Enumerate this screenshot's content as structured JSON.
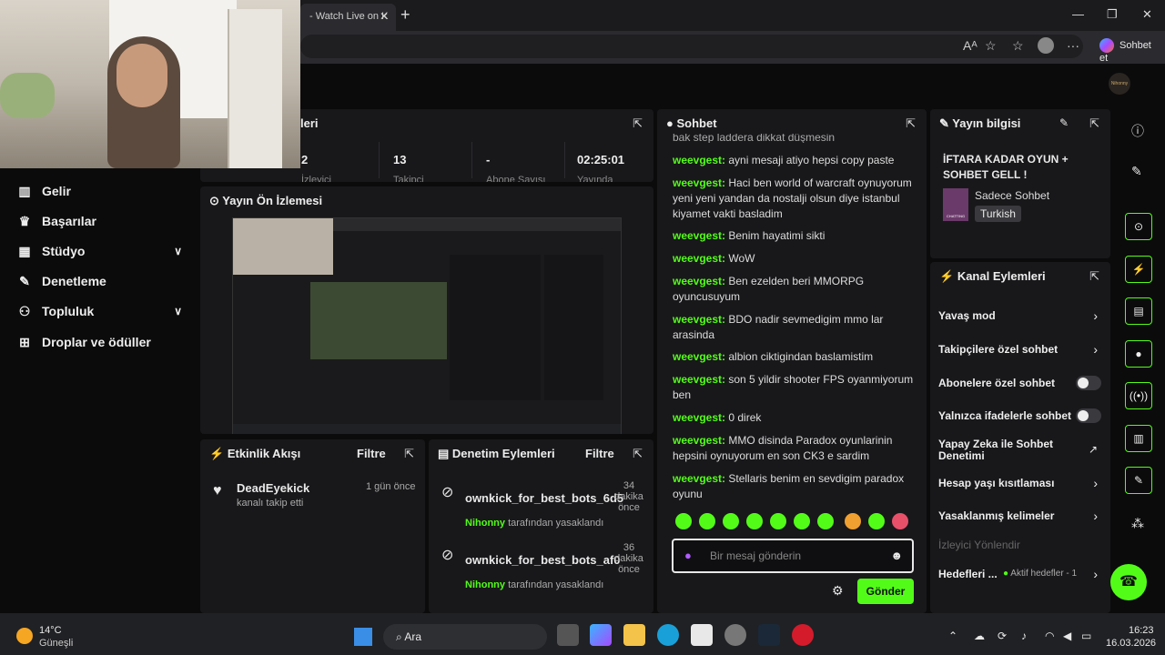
{
  "browser": {
    "tab_title": "- Watch Live on K",
    "copilot_label": "Sohbet et"
  },
  "sidebar": {
    "items": [
      {
        "label": "Gelir",
        "icon": "chart-icon"
      },
      {
        "label": "Başarılar",
        "icon": "trophy-icon"
      },
      {
        "label": "Stüdyo",
        "icon": "studio-icon",
        "expandable": true
      },
      {
        "label": "Denetleme",
        "icon": "wrench-icon"
      },
      {
        "label": "Topluluk",
        "icon": "people-icon",
        "expandable": true
      },
      {
        "label": "Droplar ve ödüller",
        "icon": "gift-icon"
      }
    ]
  },
  "stats_panel": {
    "title": "leri",
    "stats": [
      {
        "value": "2",
        "label": "İzleyici"
      },
      {
        "value": "13",
        "label": "Takipçi"
      },
      {
        "value": "-",
        "label": "Abone Sayısı"
      },
      {
        "value": "02:25:01",
        "label": "Yayında"
      }
    ]
  },
  "preview_panel": {
    "title": "Yayın Ön İzlemesi"
  },
  "activity_panel": {
    "title": "Etkinlik Akışı",
    "filter": "Filtre",
    "events": [
      {
        "user": "DeadEyekick",
        "action": "kanalı takip etti",
        "time": "1 gün önce"
      }
    ]
  },
  "mod_panel": {
    "title": "Denetim Eylemleri",
    "filter": "Filtre",
    "actions": [
      {
        "user": "ownkick_for_best_bots_6d5",
        "time_num": "34",
        "time_unit": "dakika",
        "time_ago": "önce",
        "by": "Nihonny",
        "by_suffix": "tarafından yasaklandı"
      },
      {
        "user": "ownkick_for_best_bots_af0",
        "time_num": "36",
        "time_unit": "dakika",
        "time_ago": "önce",
        "by": "Nihonny",
        "by_suffix": "tarafından yasaklandı"
      }
    ]
  },
  "chat_panel": {
    "title": "Sohbet",
    "partial_top": "bak step laddera dikkat düşmesin",
    "messages": [
      {
        "user": "weevgest:",
        "text": "ayni mesaji atiyo hepsi copy paste"
      },
      {
        "user": "weevgest:",
        "text": "Haci ben world of warcraft oynuyorum yeni yeni yandan da nostalji olsun diye istanbul kiyamet vakti basladim"
      },
      {
        "user": "weevgest:",
        "text": "Benim hayatimi sikti"
      },
      {
        "user": "weevgest:",
        "text": "WoW"
      },
      {
        "user": "weevgest:",
        "text": "Ben ezelden beri MMORPG oyuncusuyum"
      },
      {
        "user": "weevgest:",
        "text": "BDO nadir sevmedigim mmo lar arasinda"
      },
      {
        "user": "weevgest:",
        "text": "albion ciktigindan baslamistim"
      },
      {
        "user": "weevgest:",
        "text": "son 5 yildir shooter FPS oyanmiyorum ben"
      },
      {
        "user": "weevgest:",
        "text": "0 direk"
      },
      {
        "user": "weevgest:",
        "text": "MMO disinda Paradox oyunlarinin hepsini oynuyorum en son CK3 e sardim"
      },
      {
        "user": "weevgest:",
        "text": "Stellaris benim en sevdigim paradox oyunu"
      }
    ],
    "input_placeholder": "Bir mesaj gönderin",
    "send_label": "Gönder"
  },
  "stream_info": {
    "title": "Yayın bilgisi",
    "stream_title": "İFTARA KADAR OYUN + SOHBET GELL !",
    "category": "Sadece Sohbet",
    "thumb_label": "CHATTING",
    "language": "Turkish"
  },
  "channel_actions": {
    "title": "Kanal Eylemleri",
    "items": [
      {
        "label": "Yavaş mod",
        "control": "arrow"
      },
      {
        "label": "Takipçilere özel sohbet",
        "control": "arrow"
      },
      {
        "label": "Abonelere özel sohbet",
        "control": "toggle"
      },
      {
        "label": "Yalnızca ifadelerle sohbet",
        "control": "toggle"
      },
      {
        "label": "Yapay Zeka ile Sohbet Denetimi",
        "control": "external"
      },
      {
        "label": "Hesap yaşı kısıtlaması",
        "control": "arrow"
      },
      {
        "label": "Yasaklanmış kelimeler",
        "control": "arrow"
      }
    ],
    "section_label": "İzleyici Yönlendir",
    "goals_label": "Hedefleri ...",
    "goals_status": "Aktif hedefler - 1"
  },
  "topbar": {
    "avatar_text": "Nihonny"
  },
  "taskbar": {
    "weather_temp": "14°C",
    "weather_desc": "Güneşli",
    "search_label": "Ara",
    "time": "16:23",
    "date": "16.03.2026"
  },
  "colors": {
    "accent": "#53fc18",
    "panel": "#18181b",
    "background": "#0b0b0c"
  }
}
